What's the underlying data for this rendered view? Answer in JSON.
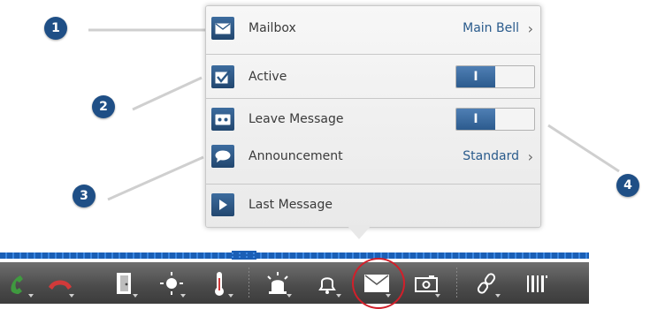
{
  "callouts": [
    "1",
    "2",
    "3",
    "4"
  ],
  "menu": {
    "rows": [
      {
        "icon": "mail-icon",
        "label": "Mailbox",
        "value": "Main Bell"
      },
      {
        "icon": "checkbox-icon",
        "label": "Active",
        "toggle": "I"
      },
      {
        "icon": "cassette-icon",
        "label": "Leave Message",
        "toggle": "I"
      },
      {
        "icon": "speech-bubble-icon",
        "label": "Announcement",
        "value": "Standard"
      },
      {
        "icon": "play-icon",
        "label": "Last Message"
      }
    ],
    "chevron": "›"
  },
  "toolbar": {
    "buttons": [
      "phone-accept-icon",
      "phone-hangup-icon",
      "door-icon",
      "light-icon",
      "thermometer-icon",
      "alarm-light-icon",
      "bell-icon",
      "mailbox-icon",
      "camera-icon",
      "link-icon",
      "barcode-icon"
    ],
    "selected": "mailbox-icon",
    "colors": {
      "accept": "#3f9a3f",
      "hangup": "#d23a3a",
      "accent": "#1b5fb5",
      "highlight": "#d21f2a"
    }
  }
}
